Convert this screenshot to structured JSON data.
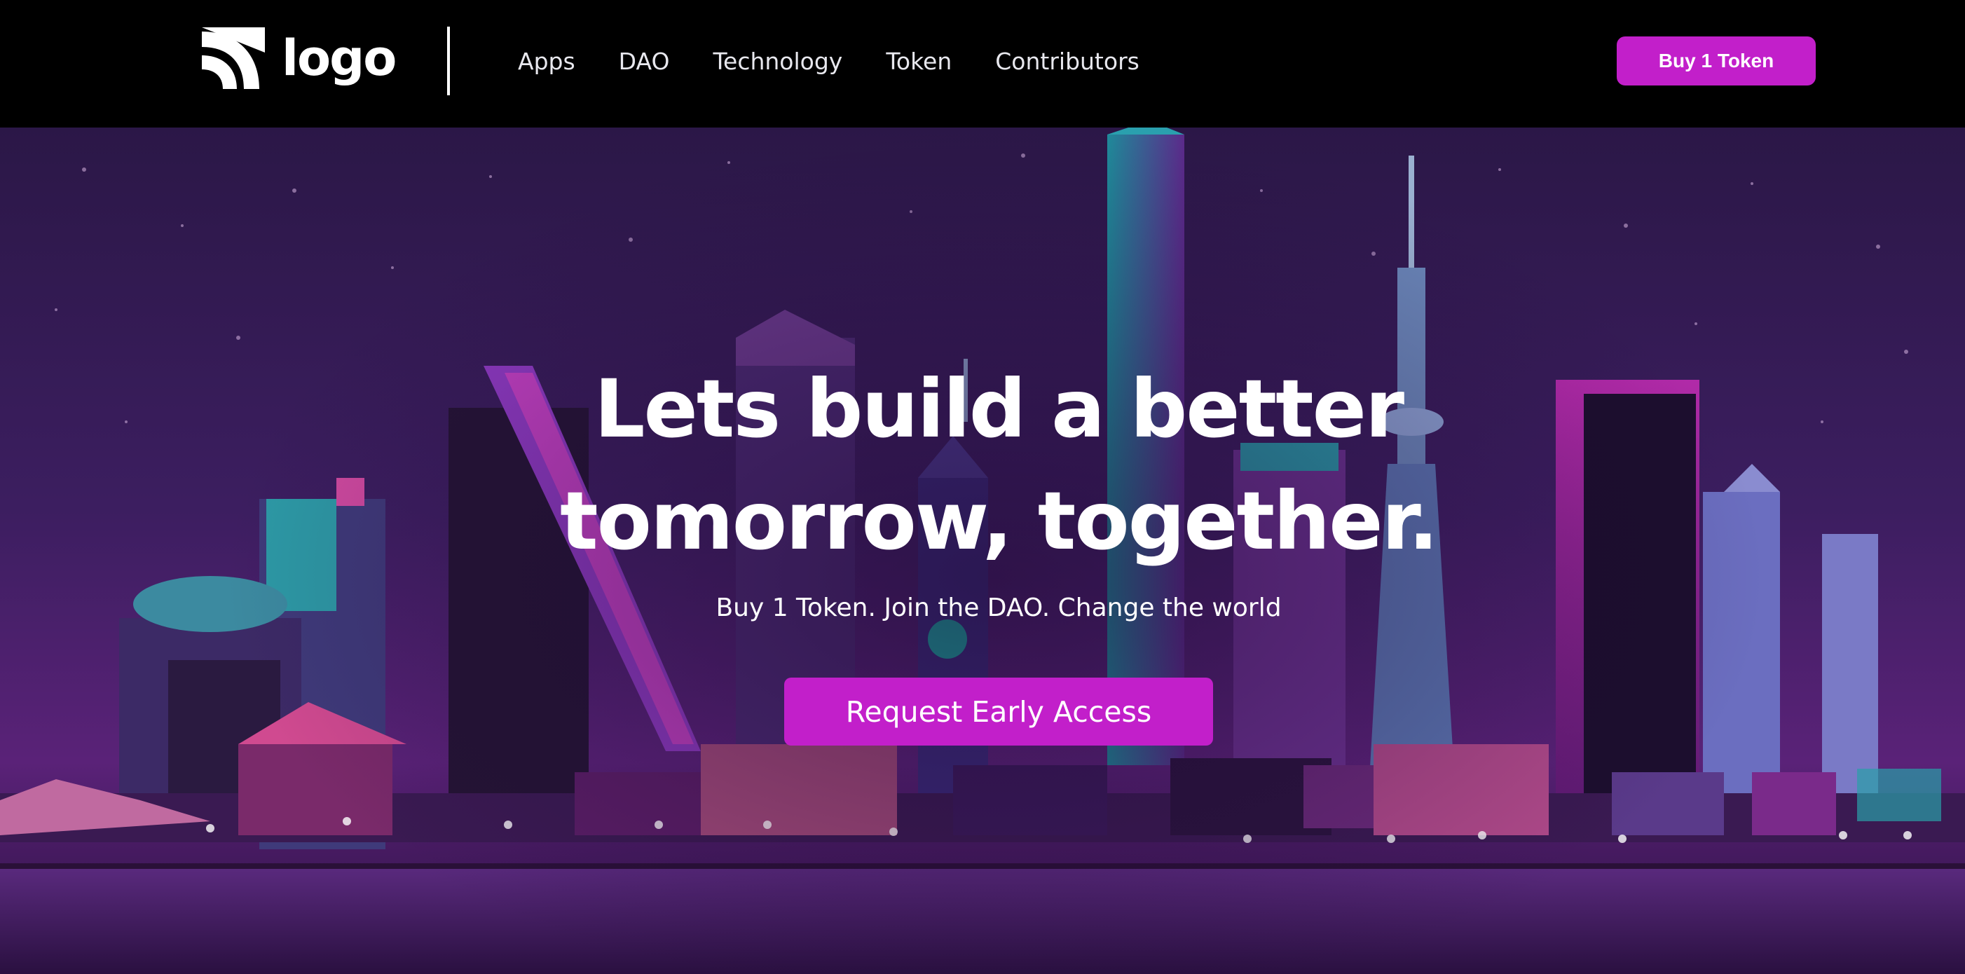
{
  "nav": {
    "logo_text": "logo",
    "links": [
      {
        "label": "Apps"
      },
      {
        "label": "DAO"
      },
      {
        "label": "Technology"
      },
      {
        "label": "Token"
      },
      {
        "label": "Contributors"
      }
    ],
    "buy_button_label": "Buy 1 Token"
  },
  "hero": {
    "headline_line1": "Lets build a better",
    "headline_line2": "tomorrow, together.",
    "subline": "Buy 1 Token. Join the DAO. Change the world",
    "cta_label": "Request Early Access"
  },
  "colors": {
    "accent": "#c21fca",
    "nav_bg": "#000000",
    "text": "#ffffff"
  },
  "icons": {
    "logo": "signal-arcs-icon"
  }
}
